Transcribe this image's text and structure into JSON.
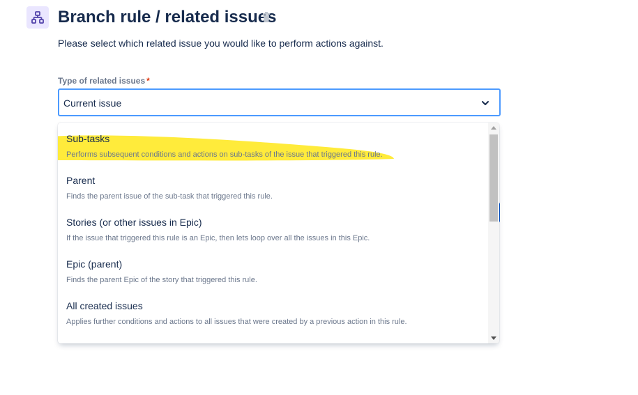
{
  "header": {
    "title": "Branch rule / related issues",
    "description": "Please select which related issue you would like to perform actions against."
  },
  "field": {
    "label": "Type of related issues",
    "required_marker": "*",
    "selected_value": "Current issue"
  },
  "dropdown": {
    "options": [
      {
        "title": "Sub-tasks",
        "description": "Performs subsequent conditions and actions on sub-tasks of the issue that triggered this rule.",
        "highlighted": true
      },
      {
        "title": "Parent",
        "description": "Finds the parent issue of the sub-task that triggered this rule.",
        "highlighted": false
      },
      {
        "title": "Stories (or other issues in Epic)",
        "description": "If the issue that triggered this rule is an Epic, then lets loop over all the issues in this Epic.",
        "highlighted": false
      },
      {
        "title": "Epic (parent)",
        "description": "Finds the parent Epic of the story that triggered this rule.",
        "highlighted": false
      },
      {
        "title": "All created issues",
        "description": "Applies further conditions and actions to all issues that were created by a previous action in this rule.",
        "highlighted": false
      }
    ]
  },
  "icons": {
    "title_icon": "branch-hierarchy-icon",
    "delete_icon": "trash-icon",
    "select_indicator": "chevron-down-icon"
  },
  "colors": {
    "title_icon_bg": "#eae6ff",
    "title_icon_fg": "#5243aa",
    "focus_border": "#4c9aff",
    "highlight": "#ffeb3b",
    "required": "#de350b"
  }
}
